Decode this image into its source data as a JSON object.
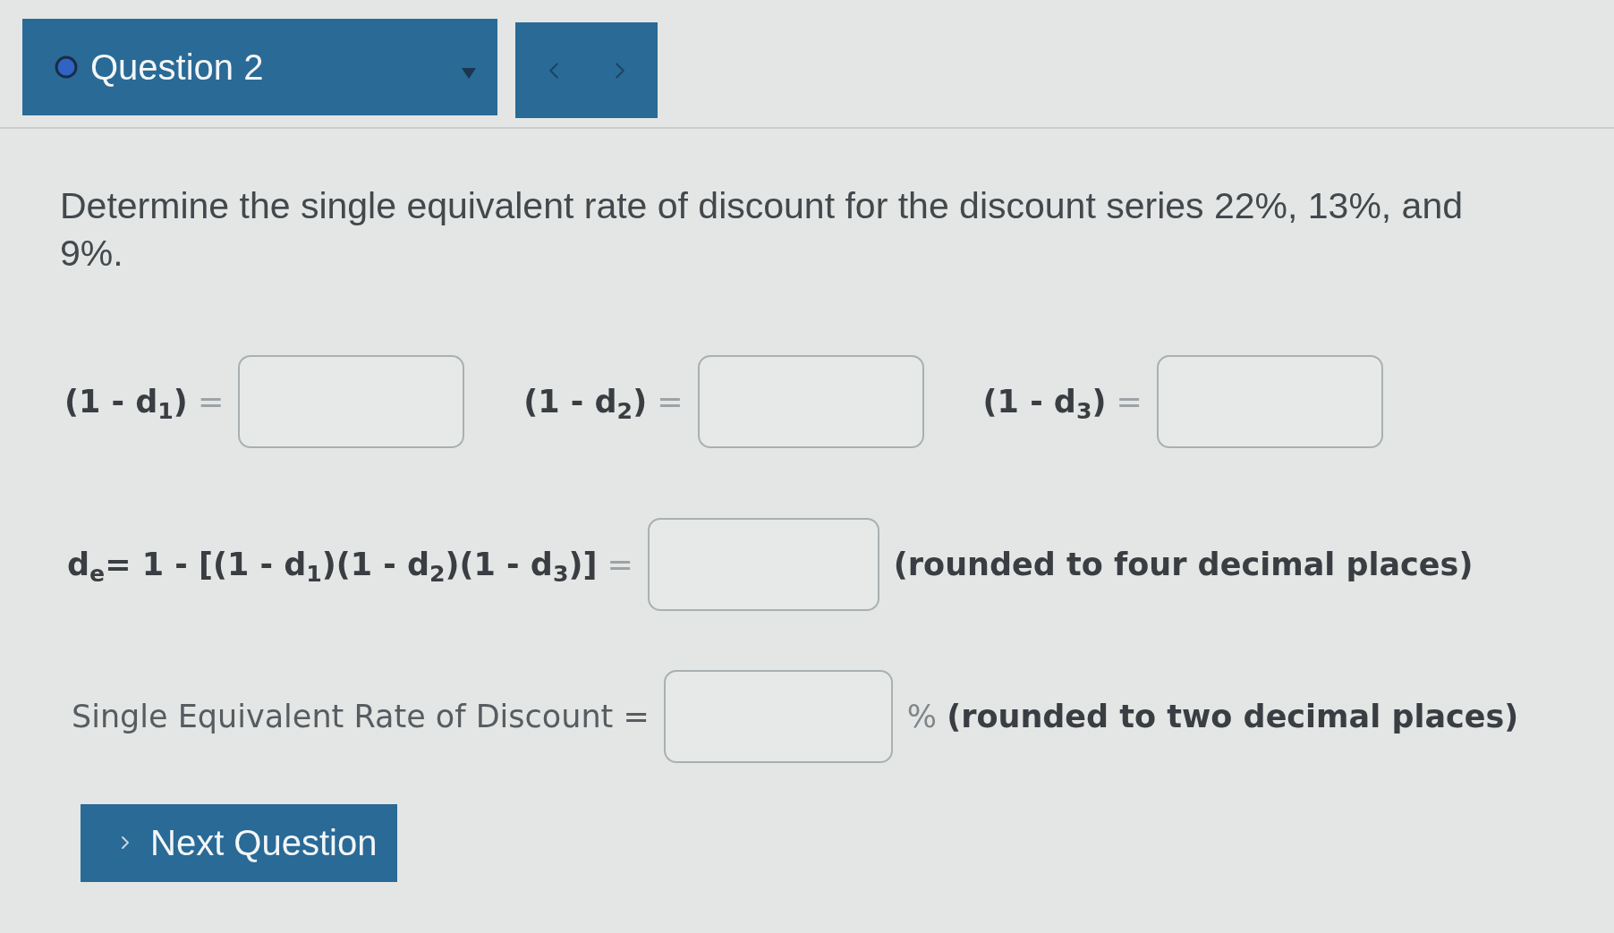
{
  "question_menu": {
    "title": "Question 2"
  },
  "question": {
    "text": "Determine the single equivalent rate of discount for the discount series 22%, 13%, and 9%."
  },
  "factor_fields": [
    {
      "label": "**(1 - d$_{1}$)** ="
    },
    {
      "label": "**(1 - d$_{2}$)** ="
    },
    {
      "label": "**(1 - d$_{3}$)** ="
    }
  ],
  "decimal_field": {
    "label": "**d$_{e}$= 1 - [(1 - d$_{1}$)(1 - d$_{2}$)(1 - d$_{3}$)]** =",
    "note": "(rounded to four decimal places)"
  },
  "percent_field": {
    "label": "Single Equivalent Rate of Discount =",
    "note": "% **(rounded to two decimal places)**"
  },
  "next_button": {
    "label": "Next Question"
  }
}
